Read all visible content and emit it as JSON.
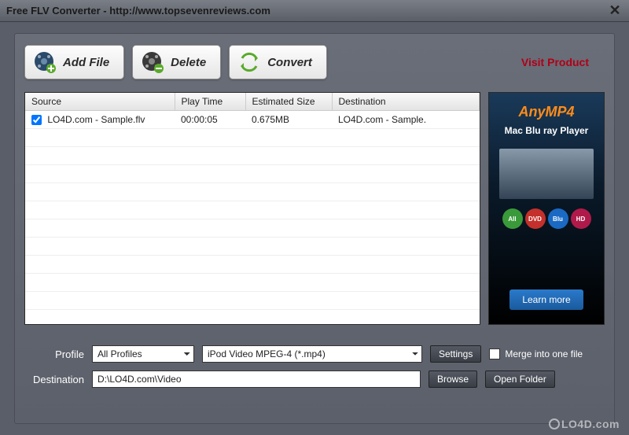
{
  "window": {
    "title": "Free FLV Converter - http://www.topsevenreviews.com"
  },
  "toolbar": {
    "add_file_label": "Add File",
    "delete_label": "Delete",
    "convert_label": "Convert",
    "visit_product_label": "Visit Product"
  },
  "table": {
    "columns": [
      "Source",
      "Play Time",
      "Estimated Size",
      "Destination"
    ],
    "rows": [
      {
        "checked": true,
        "source": "LO4D.com - Sample.flv",
        "play_time": "00:00:05",
        "est_size": "0.675MB",
        "destination": "LO4D.com - Sample."
      }
    ]
  },
  "ad": {
    "title": "AnyMP4",
    "subtitle": "Mac Blu ray Player",
    "learn_label": "Learn more",
    "badges": [
      "All",
      "DVD",
      "Blu",
      "HD"
    ]
  },
  "profile": {
    "label": "Profile",
    "select1_value": "All Profiles",
    "select2_value": "iPod Video MPEG-4 (*.mp4)",
    "settings_label": "Settings",
    "merge_label": "Merge into one file"
  },
  "destination": {
    "label": "Destination",
    "value": "D:\\LO4D.com\\Video",
    "browse_label": "Browse",
    "open_folder_label": "Open Folder"
  },
  "watermark": "LO4D.com"
}
